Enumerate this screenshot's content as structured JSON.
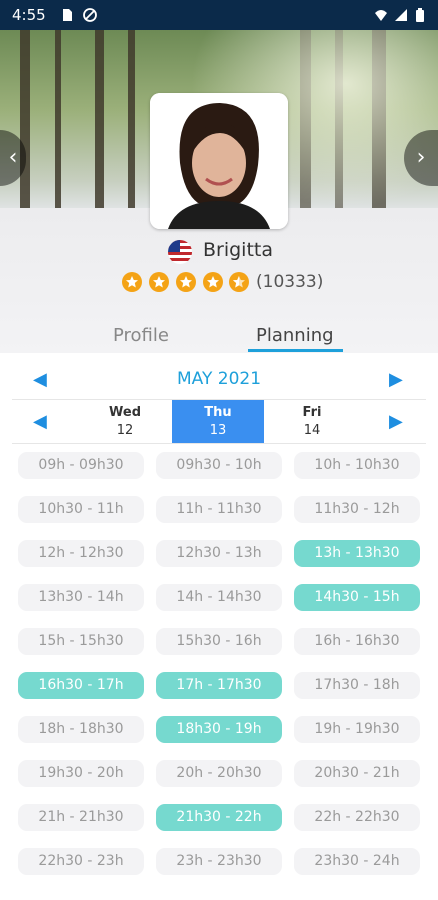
{
  "status_bar": {
    "time": "4:55"
  },
  "profile": {
    "name": "Brigitta",
    "rating": 4.5,
    "reviews": "(10333)"
  },
  "tabs": [
    {
      "label": "Profile",
      "active": false
    },
    {
      "label": "Planning",
      "active": true
    }
  ],
  "calendar": {
    "month": "MAY 2021",
    "days": [
      {
        "name": "Wed",
        "date": "12",
        "selected": false
      },
      {
        "name": "Thu",
        "date": "13",
        "selected": true
      },
      {
        "name": "Fri",
        "date": "14",
        "selected": false
      }
    ],
    "slots": [
      [
        "09h - 09h30",
        "09h30 - 10h",
        "10h - 10h30"
      ],
      [
        "10h30 - 11h",
        "11h - 11h30",
        "11h30 - 12h"
      ],
      [
        "12h - 12h30",
        "12h30 - 13h",
        "13h - 13h30"
      ],
      [
        "13h30 - 14h",
        "14h - 14h30",
        "14h30 - 15h"
      ],
      [
        "15h - 15h30",
        "15h30 - 16h",
        "16h - 16h30"
      ],
      [
        "16h30 - 17h",
        "17h - 17h30",
        "17h30 - 18h"
      ],
      [
        "18h - 18h30",
        "18h30 - 19h",
        "19h - 19h30"
      ],
      [
        "19h30 - 20h",
        "20h - 20h30",
        "20h30 - 21h"
      ],
      [
        "21h - 21h30",
        "21h30 - 22h",
        "22h - 22h30"
      ],
      [
        "22h30 - 23h",
        "23h - 23h30",
        "23h30 - 24h"
      ]
    ],
    "booked": [
      [
        false,
        false,
        false
      ],
      [
        false,
        false,
        false
      ],
      [
        false,
        false,
        true
      ],
      [
        false,
        false,
        true
      ],
      [
        false,
        false,
        false
      ],
      [
        true,
        true,
        false
      ],
      [
        false,
        true,
        false
      ],
      [
        false,
        false,
        false
      ],
      [
        false,
        true,
        false
      ],
      [
        false,
        false,
        false
      ]
    ]
  },
  "colors": {
    "status_bar": "#0b2a4a",
    "accent": "#1ea0da",
    "selected_day": "#3a8ff0",
    "booked_slot": "#76d9cf",
    "free_slot": "#f3f3f5",
    "star": "#f4a316"
  },
  "icons": [
    "sim-card-icon",
    "no-data-icon",
    "wifi-icon",
    "signal-icon",
    "battery-icon",
    "chevron-left-icon",
    "chevron-right-icon",
    "us-flag-icon",
    "star-icon"
  ]
}
